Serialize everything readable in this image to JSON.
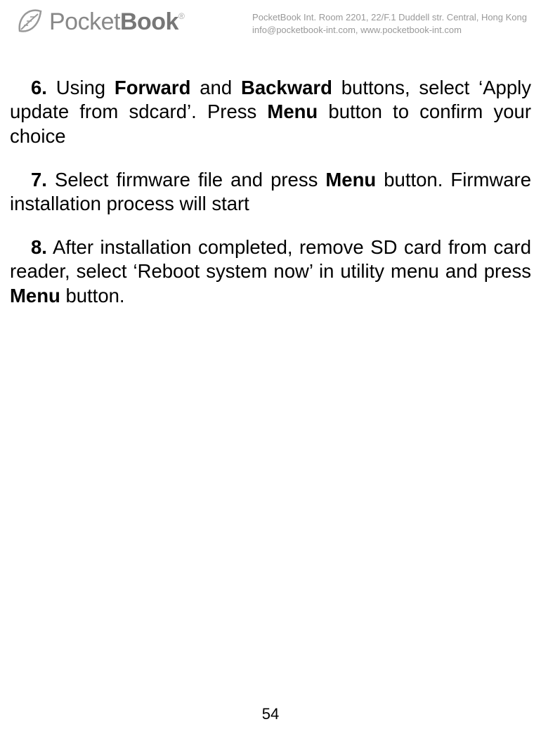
{
  "header": {
    "logo_word1": "Pocket",
    "logo_word2": "Book",
    "company_address": "PocketBook Int. Room 2201, 22/F.1 Duddell str. Central, Hong Kong",
    "company_contact": "info@pocketbook-int.com, www.pocketbook-int.com"
  },
  "steps": {
    "s6": {
      "num": "6.",
      "t1": " Using ",
      "b1": "Forward",
      "t2": " and ",
      "b2": "Backward",
      "t3": " buttons, select ‘Apply update from sdcard’. Press ",
      "b3": "Menu",
      "t4": " button to confirm your choice"
    },
    "s7": {
      "num": "7.",
      "t1": " Select firmware file and press ",
      "b1": "Menu",
      "t2": " button. Firmware installation process will start"
    },
    "s8": {
      "num": "8.",
      "t1": " After installation completed, remove SD card from card reader, select ‘Reboot system now’ in utility menu and press ",
      "b1": "Menu",
      "t2": " button."
    }
  },
  "page_number": "54"
}
